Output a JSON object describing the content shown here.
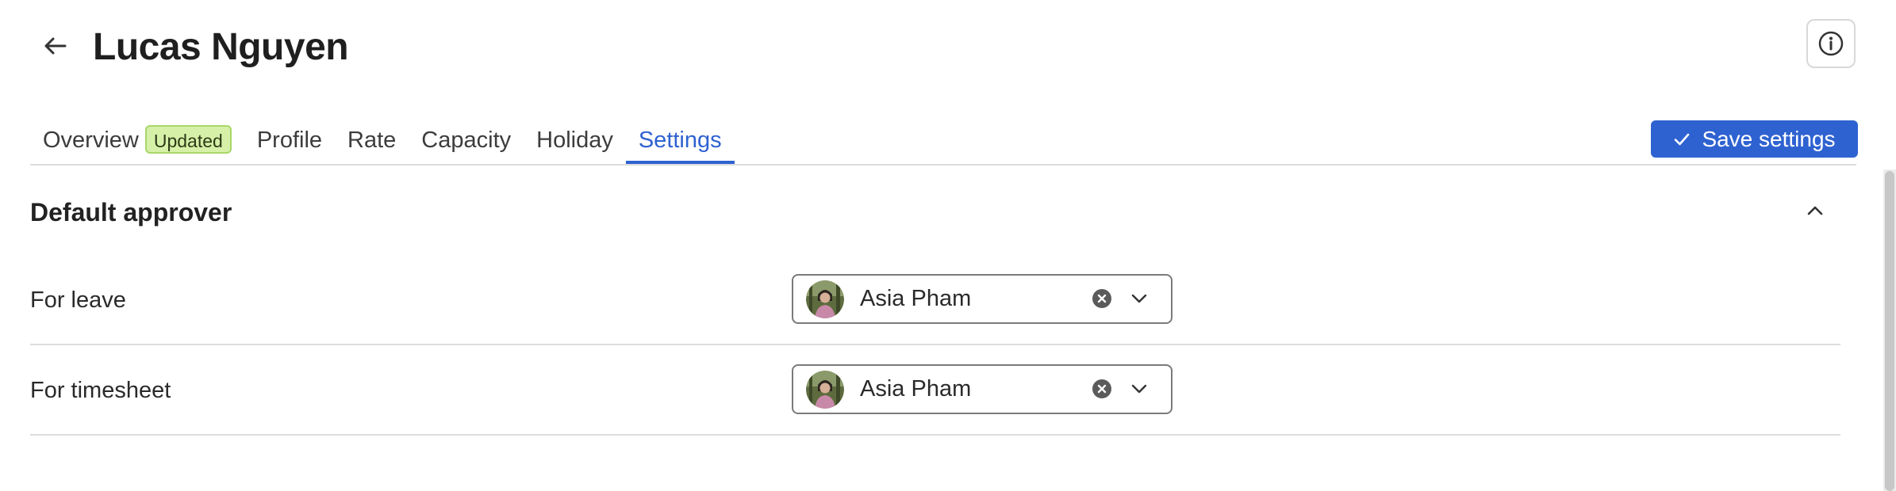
{
  "header": {
    "title": "Lucas Nguyen",
    "back_icon": "arrow-left-icon",
    "info_icon": "info-circle-icon"
  },
  "tabs": [
    {
      "label": "Overview",
      "badge": "Updated"
    },
    {
      "label": "Profile"
    },
    {
      "label": "Rate"
    },
    {
      "label": "Capacity"
    },
    {
      "label": "Holiday"
    },
    {
      "label": "Settings",
      "active": true
    }
  ],
  "toolbar": {
    "save_label": "Save settings",
    "save_icon": "check-icon"
  },
  "section": {
    "title": "Default approver",
    "collapse_icon": "chevron-up-icon"
  },
  "rows": [
    {
      "label": "For leave",
      "approver": "Asia Pham"
    },
    {
      "label": "For timesheet",
      "approver": "Asia Pham"
    }
  ],
  "colors": {
    "accent": "#2f62d1",
    "badge_bg": "#d6f0a8",
    "badge_border": "#a8d66a",
    "divider": "#dcdcdc"
  }
}
